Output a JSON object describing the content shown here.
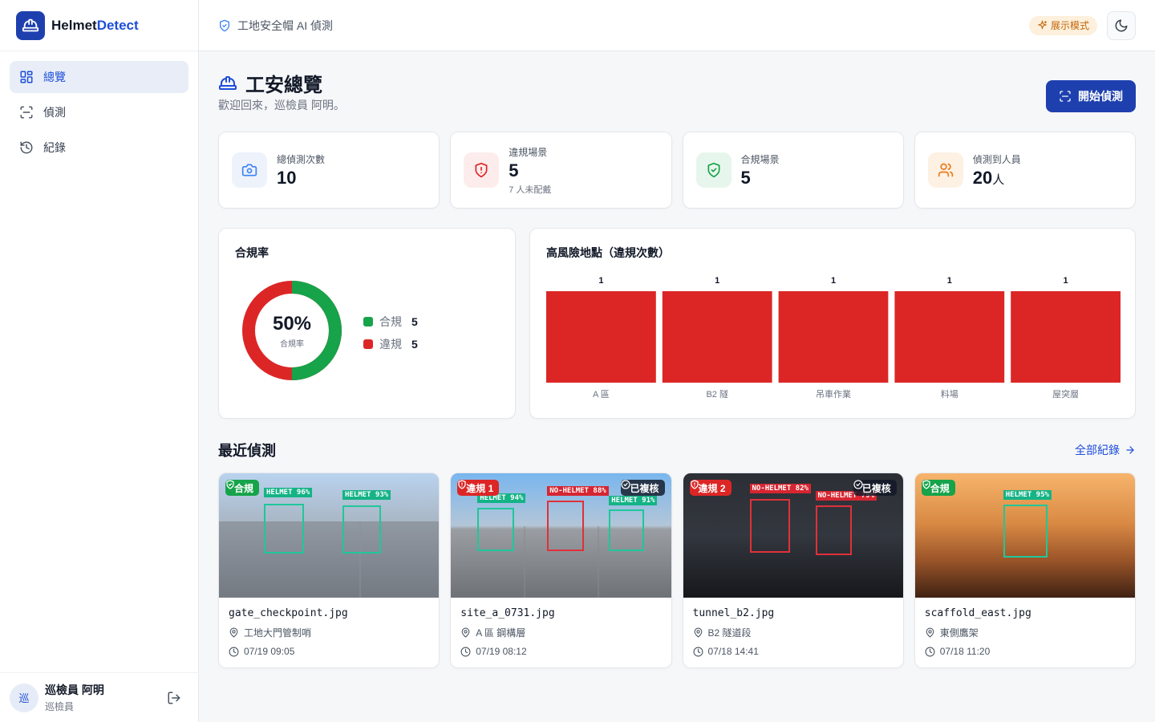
{
  "brand": {
    "name_main": "Helmet",
    "name_accent": "Detect"
  },
  "nav": [
    {
      "label": "總覽",
      "icon": "grid-icon",
      "active": true
    },
    {
      "label": "偵測",
      "icon": "scan-icon",
      "active": false
    },
    {
      "label": "紀錄",
      "icon": "history-icon",
      "active": false
    }
  ],
  "user": {
    "avatar": "巡",
    "name": "巡檢員 阿明",
    "role": "巡檢員"
  },
  "topbar": {
    "title": "工地安全帽 AI 偵測",
    "demo_badge": "展示模式"
  },
  "page": {
    "title": "工安總覽",
    "subtitle": "歡迎回來，巡檢員 阿明。",
    "start_button": "開始偵測"
  },
  "stats": [
    {
      "label": "總偵測次數",
      "value": "10",
      "unit": "",
      "note": "",
      "icon": "camera-icon",
      "bg": "#eef2fb",
      "fg": "#3b82f6"
    },
    {
      "label": "違規場景",
      "value": "5",
      "unit": "",
      "note": "7 人未配戴",
      "icon": "shield-alert-icon",
      "bg": "#fdecec",
      "fg": "#dc2626"
    },
    {
      "label": "合規場景",
      "value": "5",
      "unit": "",
      "note": "",
      "icon": "shield-check-icon",
      "bg": "#e7f6ec",
      "fg": "#16a34a"
    },
    {
      "label": "偵測到人員",
      "value": "20",
      "unit": "人",
      "note": "",
      "icon": "users-icon",
      "bg": "#fdf1e3",
      "fg": "#ea7a17"
    }
  ],
  "compliance": {
    "title": "合規率",
    "percent": "50%",
    "center_label": "合規率",
    "legend": [
      {
        "label": "合規",
        "value": "5",
        "color": "#16a34a"
      },
      {
        "label": "違規",
        "value": "5",
        "color": "#dc2626"
      }
    ]
  },
  "chart_data": {
    "type": "bar",
    "title": "高風險地點（違規次數）",
    "categories": [
      "A 區",
      "B2 隧",
      "吊車作業",
      "料場",
      "屋突層"
    ],
    "values": [
      1,
      1,
      1,
      1,
      1
    ],
    "ylim": [
      0,
      1
    ],
    "grid": false,
    "bar_color": "#dc2626"
  },
  "recent": {
    "title": "最近偵測",
    "link": "全部紀錄"
  },
  "detections": [
    {
      "file": "gate_checkpoint.jpg",
      "location": "工地大門管制哨",
      "time": "07/19 09:05",
      "status": "合規",
      "status_type": "ok",
      "reviewed": "",
      "scene": "day",
      "boxes": [
        {
          "label": "HELMET 96%",
          "type": "helmet"
        },
        {
          "label": "HELMET 93%",
          "type": "helmet"
        }
      ]
    },
    {
      "file": "site_a_0731.jpg",
      "location": "A 區 鋼構層",
      "time": "07/19 08:12",
      "status": "違規 1",
      "status_type": "bad",
      "reviewed": "已複核",
      "scene": "sky",
      "boxes": [
        {
          "label": "HELMET 94%",
          "type": "helmet"
        },
        {
          "label": "NO-HELMET 88%",
          "type": "nohelmet"
        },
        {
          "label": "HELMET 91%",
          "type": "helmet"
        }
      ]
    },
    {
      "file": "tunnel_b2.jpg",
      "location": "B2 隧道段",
      "time": "07/18 14:41",
      "status": "違規 2",
      "status_type": "bad",
      "reviewed": "已複核",
      "scene": "tunnel",
      "boxes": [
        {
          "label": "NO-HELMET 82%",
          "type": "nohelmet"
        },
        {
          "label": "NO-HELMET 79%",
          "type": "nohelmet"
        }
      ]
    },
    {
      "file": "scaffold_east.jpg",
      "location": "東側鷹架",
      "time": "07/18 11:20",
      "status": "合規",
      "status_type": "ok",
      "reviewed": "",
      "scene": "sunset",
      "boxes": [
        {
          "label": "HELMET 95%",
          "type": "helmet"
        }
      ]
    }
  ]
}
